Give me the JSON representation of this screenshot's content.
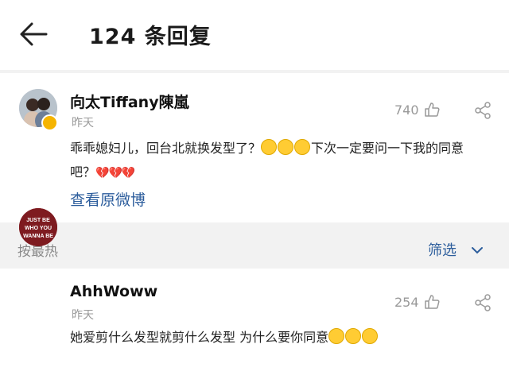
{
  "header": {
    "title": "124 条回复"
  },
  "original_comment": {
    "user": "向太Tiffany陳嵐",
    "time": "昨天",
    "likes": "740",
    "text_part1": "乖乖媳妇儿，回台北就换发型了？",
    "text_part2": "下次一定要问一下我的同意",
    "text_part3": "吧？",
    "emoji_cry_count": 3,
    "broken_hearts": "💔💔💔",
    "view_original": "查看原微博"
  },
  "sort_bar": {
    "label": "按最热",
    "filter": "筛选"
  },
  "replies": [
    {
      "user": "AhhWoww",
      "avatar_text": "JUST BE WHO YOU WANNA BE",
      "time": "昨天",
      "likes": "254",
      "text": "她爱剪什么发型就剪什么发型 为什么要你同意"
    }
  ],
  "colors": {
    "link": "#2c5d9c",
    "meta": "#9a9a9a",
    "background": "#f2f2f2"
  }
}
